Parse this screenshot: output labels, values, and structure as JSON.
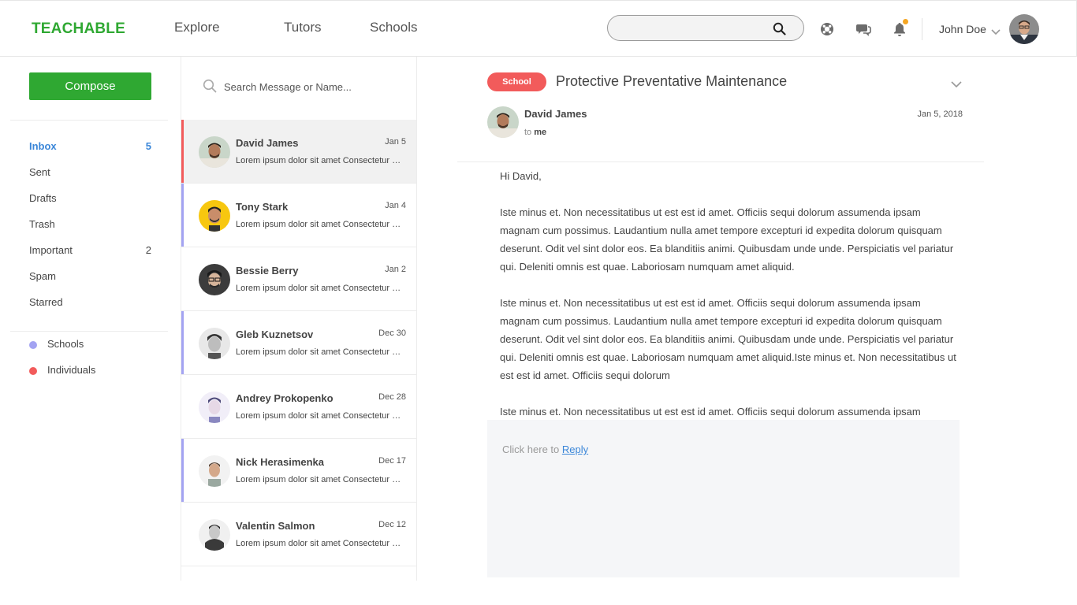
{
  "header": {
    "logo": "TEACHABLE",
    "nav": [
      "Explore",
      "Tutors",
      "Schools"
    ],
    "search": {
      "value": "",
      "placeholder": ""
    },
    "user_name": "John Doe"
  },
  "sidebar": {
    "compose_label": "Compose",
    "folders": [
      {
        "label": "Inbox",
        "count": "5"
      },
      {
        "label": "Sent",
        "count": ""
      },
      {
        "label": "Drafts",
        "count": ""
      },
      {
        "label": "Trash",
        "count": ""
      },
      {
        "label": "Important",
        "count": "2"
      },
      {
        "label": "Spam",
        "count": ""
      },
      {
        "label": "Starred",
        "count": ""
      }
    ],
    "labels": [
      {
        "label": "Schools",
        "color": "#a3a3f2"
      },
      {
        "label": "Individuals",
        "color": "#f25b5b"
      }
    ]
  },
  "message_list": {
    "search_placeholder": "Search Message or Name...",
    "messages": [
      {
        "name": "David James",
        "date": "Jan 5",
        "preview": "Lorem ipsum dolor sit amet Consectetur adipiscing",
        "selected": true,
        "accent": "#f25b5b"
      },
      {
        "name": "Tony Stark",
        "date": "Jan 4",
        "preview": "Lorem ipsum dolor sit amet Consectetur adipiscing",
        "selected": false,
        "accent": "#a3a3f2"
      },
      {
        "name": "Bessie Berry",
        "date": "Jan 2",
        "preview": "Lorem ipsum dolor sit amet Consectetur adipiscing",
        "selected": false,
        "accent": ""
      },
      {
        "name": "Gleb Kuznetsov",
        "date": "Dec 30",
        "preview": "Lorem ipsum dolor sit amet Consectetur adipiscing",
        "selected": false,
        "accent": "#a3a3f2"
      },
      {
        "name": "Andrey Prokopenko",
        "date": "Dec 28",
        "preview": "Lorem ipsum dolor sit amet Consectetur adipiscing",
        "selected": false,
        "accent": ""
      },
      {
        "name": "Nick Herasimenka",
        "date": "Dec 17",
        "preview": "Lorem ipsum dolor sit amet Consectetur adipiscing",
        "selected": false,
        "accent": "#a3a3f2"
      },
      {
        "name": "Valentin Salmon",
        "date": "Dec 12",
        "preview": "Lorem ipsum dolor sit amet Consectetur adipiscing",
        "selected": false,
        "accent": ""
      }
    ]
  },
  "reading": {
    "tag": "School",
    "subject": "Protective Preventative Maintenance",
    "sender_name": "David James",
    "to_prefix": "to",
    "to_name": "me",
    "date": "Jan 5, 2018",
    "greeting": "Hi David,",
    "paragraphs": [
      "Iste minus et. Non necessitatibus ut est est id amet. Officiis sequi dolorum assumenda ipsam magnam cum possimus. Laudantium nulla amet tempore excepturi id expedita dolorum quisquam deserunt. Odit vel sint dolor eos. Ea blanditiis animi. Quibusdam unde unde. Perspiciatis vel pariatur qui. Deleniti omnis est quae. Laboriosam numquam amet aliquid.",
      "Iste minus et. Non necessitatibus ut est est id amet. Officiis sequi dolorum assumenda ipsam magnam cum possimus. Laudantium nulla amet tempore excepturi id expedita dolorum quisquam deserunt. Odit vel sint dolor eos. Ea blanditiis animi. Quibusdam unde unde. Perspiciatis vel pariatur qui. Deleniti omnis est quae. Laboriosam numquam amet aliquid.Iste minus et. Non necessitatibus ut est est id amet. Officiis sequi dolorum",
      "Iste minus et. Non necessitatibus ut est est id amet. Officiis sequi dolorum assumenda ipsam"
    ],
    "reply_prefix": "Click here to",
    "reply_link": "Reply"
  }
}
